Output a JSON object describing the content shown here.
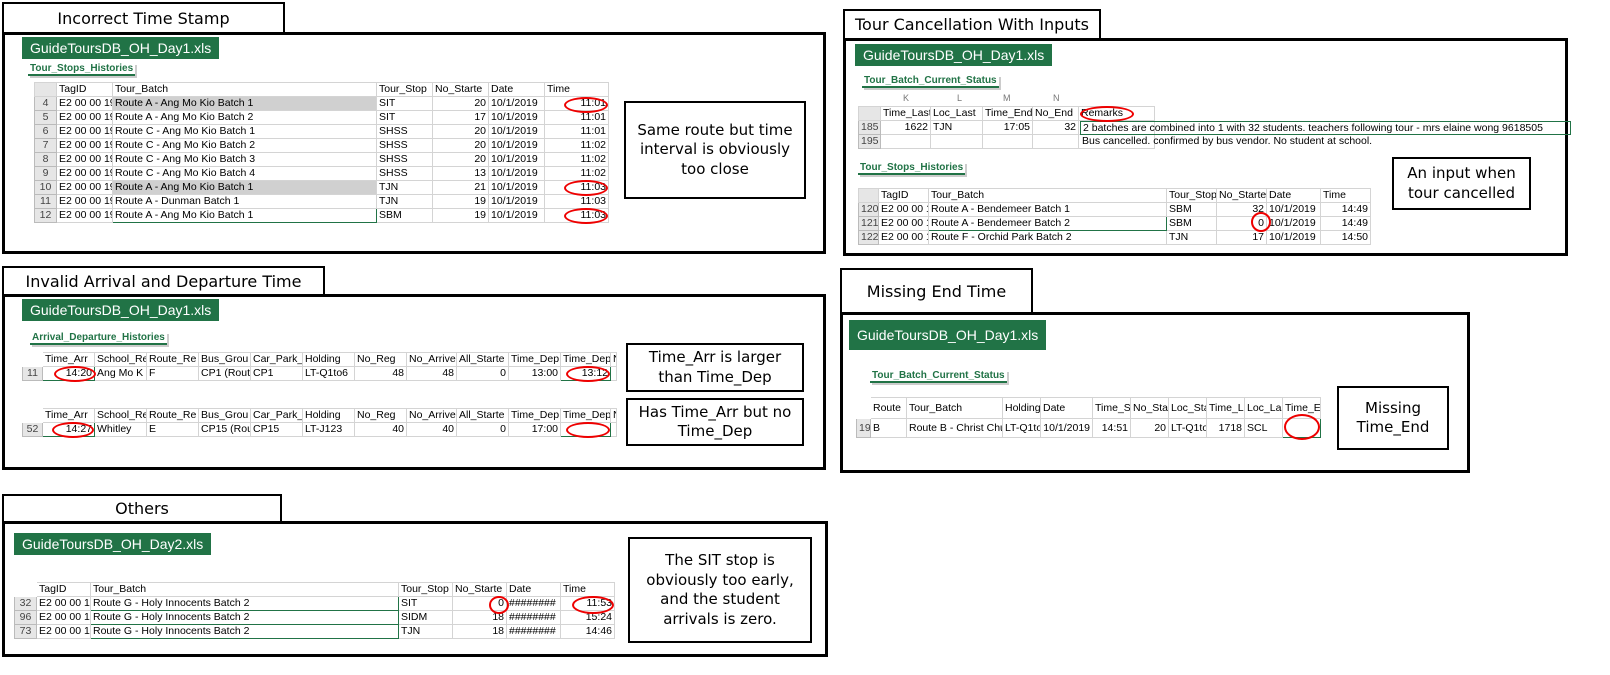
{
  "incorrect": {
    "title": "Incorrect Time Stamp",
    "file": "GuideToursDB_OH_Day1.xls",
    "sheet": "Tour_Stops_Histories",
    "headers": [
      "TagID",
      "Tour_Batch",
      "Tour_Stop",
      "No_Starte",
      "Date",
      "Time"
    ],
    "rows": [
      {
        "n": "4",
        "tag": "E2 00 00 19",
        "batch": "Route A - Ang Mo Kio Batch 1",
        "stop": "SIT",
        "no": "20",
        "date": "10/1/2019",
        "time": "11:01"
      },
      {
        "n": "5",
        "tag": "E2 00 00 19",
        "batch": "Route A - Ang Mo Kio Batch 2",
        "stop": "SIT",
        "no": "17",
        "date": "10/1/2019",
        "time": "11:01"
      },
      {
        "n": "6",
        "tag": "E2 00 00 19",
        "batch": "Route C - Ang Mo Kio Batch 1",
        "stop": "SHSS",
        "no": "20",
        "date": "10/1/2019",
        "time": "11:01"
      },
      {
        "n": "7",
        "tag": "E2 00 00 19",
        "batch": "Route C - Ang Mo Kio Batch 2",
        "stop": "SHSS",
        "no": "20",
        "date": "10/1/2019",
        "time": "11:02"
      },
      {
        "n": "8",
        "tag": "E2 00 00 19",
        "batch": "Route C - Ang Mo Kio Batch 3",
        "stop": "SHSS",
        "no": "20",
        "date": "10/1/2019",
        "time": "11:02"
      },
      {
        "n": "9",
        "tag": "E2 00 00 19",
        "batch": "Route C - Ang Mo Kio Batch 4",
        "stop": "SHSS",
        "no": "13",
        "date": "10/1/2019",
        "time": "11:02"
      },
      {
        "n": "10",
        "tag": "E2 00 00 19",
        "batch": "Route A - Ang Mo Kio Batch 1",
        "stop": "TJN",
        "no": "21",
        "date": "10/1/2019",
        "time": "11:03"
      },
      {
        "n": "11",
        "tag": "E2 00 00 19",
        "batch": "Route A - Dunman Batch 1",
        "stop": "TJN",
        "no": "19",
        "date": "10/1/2019",
        "time": "11:03"
      },
      {
        "n": "12",
        "tag": "E2 00 00 19",
        "batch": "Route A - Ang Mo Kio Batch 1",
        "stop": "SBM",
        "no": "19",
        "date": "10/1/2019",
        "time": "11:03"
      }
    ],
    "note": "Same route but time interval is obviously too close"
  },
  "cancel": {
    "title": "Tour Cancellation With Inputs",
    "file": "GuideToursDB_OH_Day1.xls",
    "sheet1": "Tour_Batch_Current_Status",
    "col_letters": [
      "K",
      "L",
      "M",
      "N"
    ],
    "headers1": [
      "Time_Last",
      "Loc_Last",
      "Time_End",
      "No_End",
      "Remarks"
    ],
    "rows1": [
      {
        "n": "185",
        "a": "1622",
        "b": "TJN",
        "c": "17:05",
        "d": "32",
        "remark": "2 batches are combined into 1 with 32 students. teachers following tour - mrs elaine wong 9618505"
      },
      {
        "n": "195",
        "a": "",
        "b": "",
        "c": "",
        "d": "",
        "remark": "Bus cancelled. confirmed by bus vendor. No student at school."
      }
    ],
    "sheet2": "Tour_Stops_Histories",
    "headers2": [
      "TagID",
      "Tour_Batch",
      "Tour_Stop",
      "No_Starte",
      "Date",
      "Time"
    ],
    "rows2": [
      {
        "n": "120",
        "tag": "E2 00 00 19",
        "batch": "Route A - Bendemeer Batch 1",
        "stop": "SBM",
        "no": "32",
        "date": "10/1/2019",
        "time": "14:49"
      },
      {
        "n": "121",
        "tag": "E2 00 00 19",
        "batch": "Route A - Bendemeer Batch 2",
        "stop": "SBM",
        "no": "0",
        "date": "10/1/2019",
        "time": "14:49"
      },
      {
        "n": "122",
        "tag": "E2 00 00 19",
        "batch": "Route F - Orchid Park Batch 2",
        "stop": "TJN",
        "no": "17",
        "date": "10/1/2019",
        "time": "14:50"
      }
    ],
    "note": "An input when tour cancelled"
  },
  "invalid": {
    "title": "Invalid Arrival and Departure Time",
    "file": "GuideToursDB_OH_Day1.xls",
    "sheet": "Arrival_Departure_Histories",
    "headers": [
      "Time_Arr",
      "School_Re",
      "Route_Re",
      "Bus_Grou",
      "Car_Park_",
      "Holding",
      "No_Reg",
      "No_Arrive",
      "All_Starte",
      "Time_Dep",
      "Time_Dep",
      "N"
    ],
    "row1": {
      "n": "11",
      "c": [
        "14:20",
        "Ang Mo K",
        "F",
        "CP1 (Rout",
        "CP1",
        "LT-Q1to6",
        "48",
        "48",
        "0",
        "13:00",
        "13:12",
        ""
      ]
    },
    "row2": {
      "n": "52",
      "c": [
        "14:27",
        "Whitley",
        "E",
        "CP15 (Rou",
        "CP15",
        "LT-J123",
        "40",
        "40",
        "0",
        "17:00",
        "",
        ""
      ]
    },
    "note1": "Time_Arr is larger than Time_Dep",
    "note2": "Has Time_Arr but no Time_Dep"
  },
  "missing": {
    "title": "Missing End Time",
    "file": "GuideToursDB_OH_Day1.xls",
    "sheet": "Tour_Batch_Current_Status",
    "headers": [
      "Route",
      "Tour_Batch",
      "Holding",
      "Date",
      "Time_Star",
      "No_Starte",
      "Loc_Starte",
      "Time_Last",
      "Loc_Last",
      "Time_End"
    ],
    "row": {
      "n": "197",
      "c": [
        "B",
        "Route B - Christ Church Bat",
        "LT-Q1to6",
        "10/1/2019",
        "14:51",
        "20",
        "LT-Q1to6",
        "1718",
        "SCL",
        ""
      ]
    },
    "note": "Missing Time_End"
  },
  "others": {
    "title": "Others",
    "file": "GuideToursDB_OH_Day2.xls",
    "headers": [
      "TagID",
      "Tour_Batch",
      "Tour_Stop",
      "No_Starte",
      "Date",
      "Time"
    ],
    "rows": [
      {
        "n": "32",
        "tag": "E2 00 00 19",
        "batch": "Route G - Holy Innocents Batch 2",
        "stop": "SIT",
        "no": "0",
        "date": "########",
        "time": "11:53"
      },
      {
        "n": "96",
        "tag": "E2 00 00 19",
        "batch": "Route G - Holy Innocents Batch 2",
        "stop": "SIDM",
        "no": "18",
        "date": "########",
        "time": "15:24"
      },
      {
        "n": "73",
        "tag": "E2 00 00 19",
        "batch": "Route G - Holy Innocents Batch 2",
        "stop": "TJN",
        "no": "18",
        "date": "########",
        "time": "14:46"
      }
    ],
    "note": "The SIT stop is obviously too early, and the student arrivals is zero."
  }
}
